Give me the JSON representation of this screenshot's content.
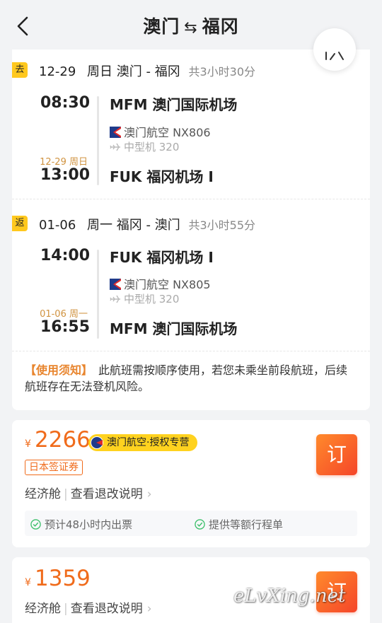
{
  "header": {
    "origin": "澳门",
    "round_trip_arrow": "⇆",
    "destination": "福冈"
  },
  "segments": [
    {
      "tag": "去",
      "date": "12-29",
      "weekday": "周日",
      "route": "澳门 - 福冈",
      "duration": "共3小时30分",
      "dep_time": "08:30",
      "dep_airport": "MFM 澳门国际机场",
      "airline": "澳门航空 NX806",
      "aircraft": "中型机 320",
      "arr_date_note": "12-29 周日",
      "arr_time": "13:00",
      "arr_airport": "FUK 福冈机场 I"
    },
    {
      "tag": "返",
      "date": "01-06",
      "weekday": "周一",
      "route": "福冈 - 澳门",
      "duration": "共3小时55分",
      "dep_time": "14:00",
      "dep_airport": "FUK 福冈机场 I",
      "airline": "澳门航空 NX805",
      "aircraft": "中型机 320",
      "arr_date_note": "01-06 周一",
      "arr_time": "16:55",
      "arr_airport": "MFM 澳门国际机场"
    }
  ],
  "notice": {
    "title": "【使用须知】",
    "text": "此航班需按顺序使用，若您未乘坐前段航班，后续航班存在无法登机风险。"
  },
  "offers": [
    {
      "currency": "¥",
      "price": "2266",
      "badge": "澳门航空·授权专营",
      "visa_tag": "日本签证券",
      "cabin": "经济舱",
      "refund_link": "查看退改说明",
      "book_label": "订",
      "perks": [
        "预计48小时内出票",
        "提供等额行程单"
      ]
    },
    {
      "currency": "¥",
      "price": "1359",
      "cabin": "经济舱",
      "refund_link": "查看退改说明",
      "book_label": "订"
    }
  ],
  "watermark": "eLvXing.net",
  "colors": {
    "accent_orange": "#f06b1b",
    "tag_yellow": "#ffc81e",
    "notice_orange": "#e8852e"
  },
  "icons": [
    "back-arrow-icon",
    "share-icon",
    "airline-logo-icon",
    "plane-icon",
    "check-circle-icon",
    "chevron-right-icon"
  ]
}
